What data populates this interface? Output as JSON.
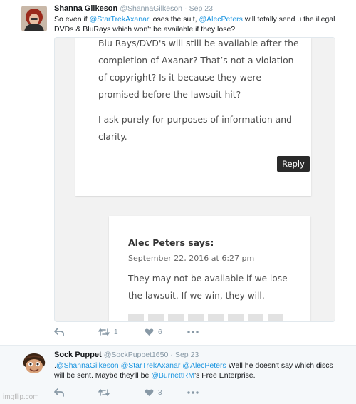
{
  "tweet1": {
    "name": "Shanna Gilkeson",
    "handle": "@ShannaGilkeson",
    "separator": "·",
    "date": "Sep 23",
    "text_parts": {
      "p1": "So even if ",
      "m1": "@StarTrekAxanar",
      "p2": " loses the suit, ",
      "m2": "@AlecPeters",
      "p3": " will totally send u the illegal DVDs & BluRays which won't be available if they lose?"
    },
    "card": {
      "comment1_lines": {
        "line1": "Blu Rays/DVD's will still be available after the",
        "line2": "completion of Axanar? That’s not a violation",
        "line3": "of copyright? Is it because they were",
        "line4": "promised before the lawsuit hit?",
        "para2_line1": "I ask purely for purposes of information and",
        "para2_line2": "clarity."
      },
      "reply_label": "Reply",
      "comment2_author": "Alec Peters says:",
      "comment2_date": "September 22, 2016 at 6:27 pm",
      "comment2_line1": "They may not be available if we lose",
      "comment2_line2": "the lawsuit. If we win, they will."
    },
    "actions": {
      "retweet_count": "1",
      "like_count": "6"
    }
  },
  "tweet2": {
    "name": "Sock Puppet",
    "handle": "@SockPuppet1650",
    "separator": "·",
    "date": "Sep 23",
    "text_parts": {
      "p0": ".",
      "m1": "@ShannaGilkeson",
      "p1": " ",
      "m2": "@StarTrekAxanar",
      "p2": " ",
      "m3": "@AlecPeters",
      "p3": " Well he doesn't say which discs will be sent. Maybe they'll be ",
      "m4": "@BurnettRM",
      "p4": "'s Free Enterprise."
    },
    "actions": {
      "retweet_count": "",
      "like_count": "3"
    }
  },
  "watermark": "imgflip.com",
  "colors": {
    "link": "#1b95e0",
    "muted": "#8899a6",
    "reply_button": "#2a2a2a"
  }
}
